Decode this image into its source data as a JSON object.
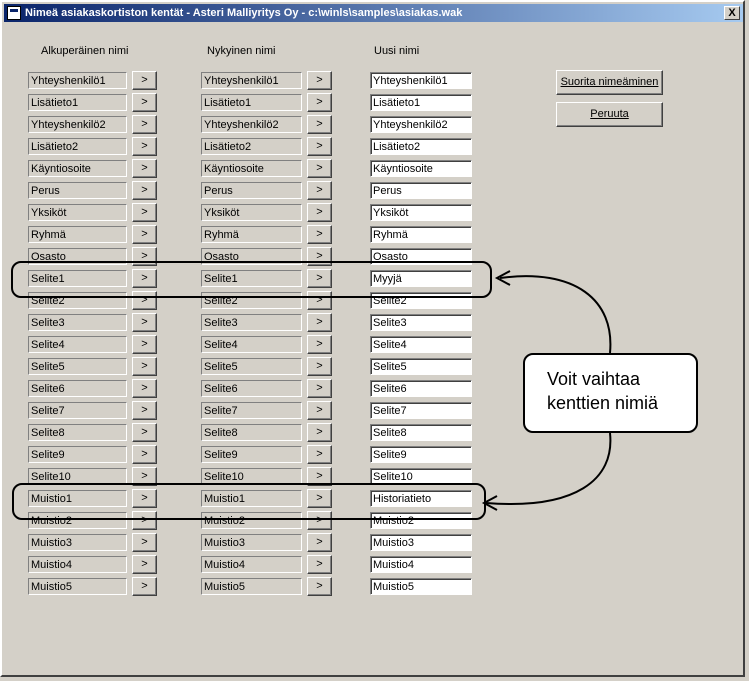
{
  "window": {
    "title": "Nimeä asiakaskortiston kentät - Asteri Malliyritys Oy - c:\\winls\\samples\\asiakas.wak",
    "close_label": "X"
  },
  "headers": {
    "original": "Alkuperäinen nimi",
    "current": "Nykyinen nimi",
    "new": "Uusi nimi"
  },
  "copy_button_label": ">",
  "buttons": {
    "execute": "Suorita nimeäminen",
    "cancel": "Peruuta"
  },
  "rows": [
    {
      "original": "Yhteyshenkilö1",
      "current": "Yhteyshenkilö1",
      "new": "Yhteyshenkilö1"
    },
    {
      "original": "Lisätieto1",
      "current": "Lisätieto1",
      "new": "Lisätieto1"
    },
    {
      "original": "Yhteyshenkilö2",
      "current": "Yhteyshenkilö2",
      "new": "Yhteyshenkilö2"
    },
    {
      "original": "Lisätieto2",
      "current": "Lisätieto2",
      "new": "Lisätieto2"
    },
    {
      "original": "Käyntiosoite",
      "current": "Käyntiosoite",
      "new": "Käyntiosoite"
    },
    {
      "original": "Perus",
      "current": "Perus",
      "new": "Perus"
    },
    {
      "original": "Yksiköt",
      "current": "Yksiköt",
      "new": "Yksiköt"
    },
    {
      "original": "Ryhmä",
      "current": "Ryhmä",
      "new": "Ryhmä"
    },
    {
      "original": "Osasto",
      "current": "Osasto",
      "new": "Osasto"
    },
    {
      "original": "Selite1",
      "current": "Selite1",
      "new": "Myyjä"
    },
    {
      "original": "Selite2",
      "current": "Selite2",
      "new": "Selite2"
    },
    {
      "original": "Selite3",
      "current": "Selite3",
      "new": "Selite3"
    },
    {
      "original": "Selite4",
      "current": "Selite4",
      "new": "Selite4"
    },
    {
      "original": "Selite5",
      "current": "Selite5",
      "new": "Selite5"
    },
    {
      "original": "Selite6",
      "current": "Selite6",
      "new": "Selite6"
    },
    {
      "original": "Selite7",
      "current": "Selite7",
      "new": "Selite7"
    },
    {
      "original": "Selite8",
      "current": "Selite8",
      "new": "Selite8"
    },
    {
      "original": "Selite9",
      "current": "Selite9",
      "new": "Selite9"
    },
    {
      "original": "Selite10",
      "current": "Selite10",
      "new": "Selite10"
    },
    {
      "original": "Muistio1",
      "current": "Muistio1",
      "new": "Historiatieto"
    },
    {
      "original": "Muistio2",
      "current": "Muistio2",
      "new": "Muistio2"
    },
    {
      "original": "Muistio3",
      "current": "Muistio3",
      "new": "Muistio3"
    },
    {
      "original": "Muistio4",
      "current": "Muistio4",
      "new": "Muistio4"
    },
    {
      "original": "Muistio5",
      "current": "Muistio5",
      "new": "Muistio5"
    }
  ],
  "callout": {
    "text": "Voit vaihtaa\nkenttien nimiä"
  }
}
